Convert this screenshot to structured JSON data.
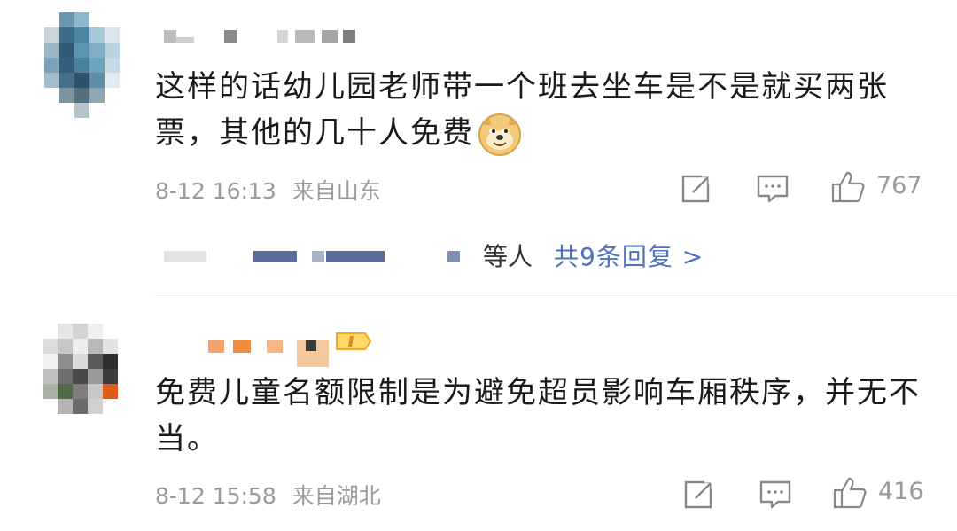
{
  "comments": [
    {
      "text": "这样的话幼儿园老师带一个班去坐车是不是就买两张票，其他的几十人免费",
      "emoji": "doge-emoji",
      "date": "8-12 16:13",
      "location": "来自山东",
      "likes": "767",
      "replies": {
        "suffix": "等人",
        "link": "共9条回复 >"
      }
    },
    {
      "text": "免费儿童名额限制是为避免超员影响车厢秩序，并无不当。",
      "date": "8-12 15:58",
      "location": "来自湖北",
      "likes": "416"
    }
  ],
  "colors": {
    "text": "#1a1a1a",
    "meta": "#9a9a9a",
    "link": "#4f72b8",
    "badge": "#f5a623"
  },
  "icons": [
    "share-icon",
    "comment-icon",
    "thumbs-up-icon"
  ]
}
